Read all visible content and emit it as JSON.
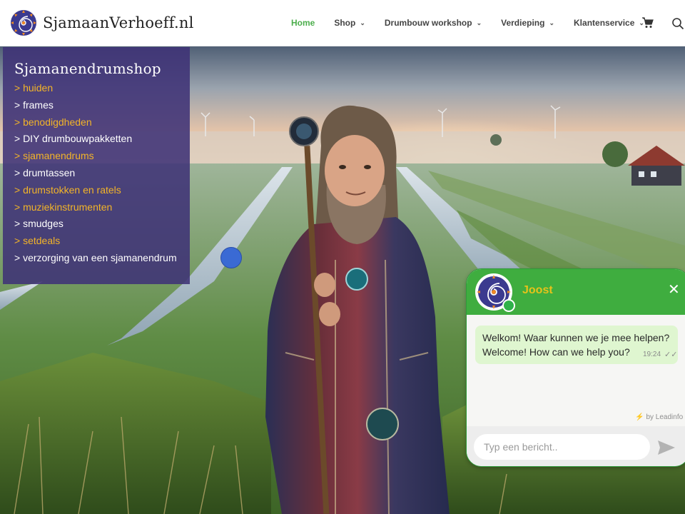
{
  "site": {
    "name": "SjamaanVerhoeff.nl",
    "logo_icon": "spiral-logo-icon"
  },
  "nav": {
    "items": [
      {
        "label": "Home",
        "active": true,
        "has_dropdown": false
      },
      {
        "label": "Shop",
        "active": false,
        "has_dropdown": true
      },
      {
        "label": "Drumbouw workshop",
        "active": false,
        "has_dropdown": true
      },
      {
        "label": "Verdieping",
        "active": false,
        "has_dropdown": true
      },
      {
        "label": "Klantenservice",
        "active": false,
        "has_dropdown": true
      }
    ],
    "active_color": "#4cae4c",
    "icons": [
      "cart-icon",
      "search-icon"
    ]
  },
  "category_panel": {
    "title": "Sjamanendrumshop",
    "items": [
      {
        "label": "> huiden",
        "highlight": true
      },
      {
        "label": "> frames",
        "highlight": false
      },
      {
        "label": "> benodigdheden",
        "highlight": true
      },
      {
        "label": "> DIY drumbouwpakketten",
        "highlight": false
      },
      {
        "label": "> sjamanendrums",
        "highlight": true
      },
      {
        "label": "> drumtassen",
        "highlight": false
      },
      {
        "label": "> drumstokken en ratels",
        "highlight": true
      },
      {
        "label": "> muziekinstrumenten",
        "highlight": true
      },
      {
        "label": "> smudges",
        "highlight": false
      },
      {
        "label": "> setdeals",
        "highlight": true
      },
      {
        "label": "> verzorging van een sjamanendrum",
        "highlight": false
      }
    ],
    "highlight_color": "#f3b428",
    "background_color": "#3f3276"
  },
  "chat": {
    "agent_name": "Joost",
    "close_icon": "close-icon",
    "message": {
      "line1": "Welkom! Waar kunnen we je mee helpen?",
      "line2": "Welcome! How can we help you?",
      "time": "19:24",
      "status_icon": "double-check-icon"
    },
    "powered_by": "by Leadinfo",
    "input_placeholder": "Typ een bericht..",
    "send_icon": "send-icon",
    "header_color": "#3fad3f"
  }
}
